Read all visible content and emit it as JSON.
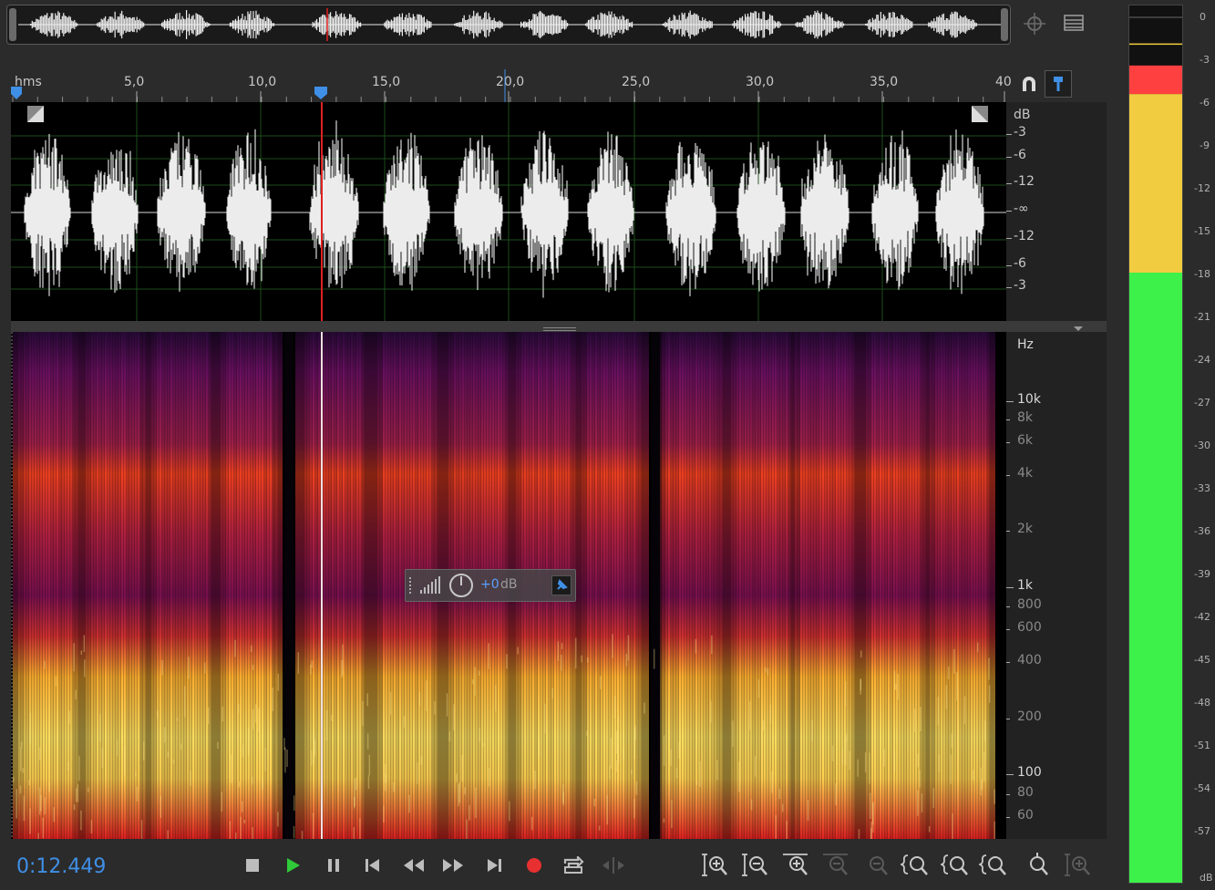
{
  "ruler": {
    "unit_label": "hms",
    "ticks": [
      "5,0",
      "10,0",
      "15,0",
      "20,0",
      "25,0",
      "30,0",
      "35,0",
      "40"
    ]
  },
  "db_scale": {
    "unit": "dB",
    "labels": [
      "-3",
      "-6",
      "-12",
      "-∞",
      "-12",
      "-6",
      "-3"
    ]
  },
  "hz_scale": {
    "unit": "Hz",
    "labels": [
      {
        "text": "10k",
        "major": true
      },
      {
        "text": "8k",
        "major": false
      },
      {
        "text": "6k",
        "major": false
      },
      {
        "text": "4k",
        "major": false
      },
      {
        "text": "2k",
        "major": false
      },
      {
        "text": "1k",
        "major": true
      },
      {
        "text": "800",
        "major": false
      },
      {
        "text": "600",
        "major": false
      },
      {
        "text": "400",
        "major": false
      },
      {
        "text": "200",
        "major": false
      },
      {
        "text": "100",
        "major": true
      },
      {
        "text": "80",
        "major": false
      },
      {
        "text": "60",
        "major": false
      }
    ]
  },
  "hud": {
    "value": "+0",
    "unit": "dB"
  },
  "transport": {
    "timecode": "0:12.449",
    "buttons": [
      "stop",
      "play",
      "pause",
      "move-to-previous",
      "rewind",
      "fast-forward",
      "move-to-next",
      "record",
      "loop-playback",
      "skip-selection"
    ]
  },
  "zoom_tools": [
    "zoom-in-amplitude",
    "zoom-out-amplitude",
    "zoom-in-time",
    "zoom-out-time",
    "zoom-out-full",
    "zoom-in-at-in-point",
    "zoom-in-at-out-point",
    "zoom-to-selection",
    "zoom-to-playhead",
    "zoom-in-time-fit"
  ],
  "meter": {
    "labels": [
      "0",
      "-3",
      "-6",
      "-9",
      "-12",
      "-15",
      "-18",
      "-21",
      "-24",
      "-27",
      "-30",
      "-33",
      "-36",
      "-39",
      "-42",
      "-45",
      "-48",
      "-51",
      "-54",
      "-57",
      "dB"
    ],
    "peak_hold_db": -2,
    "clip_color": "#ff4040",
    "yellow_color": "#f2cc40",
    "green_color": "#3df04a"
  },
  "colors": {
    "accent": "#3f8fe6",
    "playhead": "#e02020",
    "waveform": "#e8e8e8",
    "play_green": "#2fcb38",
    "record_red": "#e83030"
  }
}
